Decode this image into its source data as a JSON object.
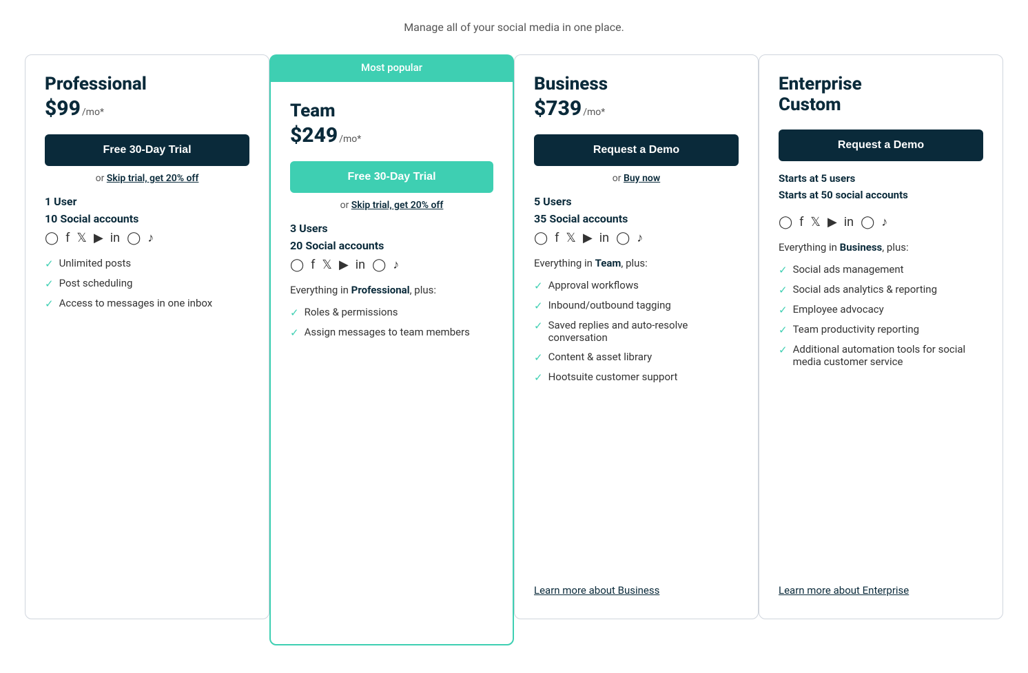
{
  "subtitle": "Manage all of your social media in one place.",
  "plans": [
    {
      "id": "professional",
      "name": "Professional",
      "price": "$99",
      "period": "/mo*",
      "badge": null,
      "primary_button": "Free 30-Day Trial",
      "primary_button_style": "dark",
      "secondary_link": "or",
      "secondary_link_text": "Skip trial, get 20% off",
      "users": "1 User",
      "social_accounts": "10 Social accounts",
      "social_icons": [
        "ⓘ",
        "f",
        "𝕏",
        "▶",
        "in",
        "ⓟ",
        "♪"
      ],
      "everything_in": null,
      "features": [
        "Unlimited posts",
        "Post scheduling",
        "Access to messages in one inbox"
      ],
      "learn_more": null,
      "starts_at": null,
      "starts_at2": null
    },
    {
      "id": "team",
      "name": "Team",
      "price": "$249",
      "period": "/mo*",
      "badge": "Most popular",
      "primary_button": "Free 30-Day Trial",
      "primary_button_style": "green",
      "secondary_link": "or",
      "secondary_link_text": "Skip trial, get 20% off",
      "users": "3 Users",
      "social_accounts": "20 Social accounts",
      "social_icons": [
        "ⓘ",
        "f",
        "𝕏",
        "▶",
        "in",
        "ⓟ",
        "♪"
      ],
      "everything_in": "Professional",
      "features": [
        "Roles & permissions",
        "Assign messages to team members"
      ],
      "learn_more": null,
      "starts_at": null,
      "starts_at2": null
    },
    {
      "id": "business",
      "name": "Business",
      "price": "$739",
      "period": "/mo*",
      "badge": null,
      "primary_button": "Request a Demo",
      "primary_button_style": "dark",
      "secondary_link": "or",
      "secondary_link_text": "Buy now",
      "users": "5 Users",
      "social_accounts": "35 Social accounts",
      "social_icons": [
        "ⓘ",
        "f",
        "𝕏",
        "▶",
        "in",
        "ⓟ",
        "♪"
      ],
      "everything_in": "Team",
      "features": [
        "Approval workflows",
        "Inbound/outbound tagging",
        "Saved replies and auto-resolve conversation",
        "Content & asset library",
        "Hootsuite customer support"
      ],
      "learn_more": "Learn more about Business",
      "starts_at": null,
      "starts_at2": null
    },
    {
      "id": "enterprise",
      "name": "Enterprise",
      "name2": "Custom",
      "price": null,
      "period": null,
      "badge": null,
      "primary_button": "Request a Demo",
      "primary_button_style": "dark",
      "secondary_link": null,
      "secondary_link_text": null,
      "users": null,
      "social_accounts": null,
      "social_icons": [
        "ⓘ",
        "f",
        "𝕏",
        "▶",
        "in",
        "ⓟ",
        "♪"
      ],
      "everything_in": "Business",
      "features": [
        "Social ads management",
        "Social ads analytics & reporting",
        "Employee advocacy",
        "Team productivity reporting",
        "Additional automation tools for social media customer service"
      ],
      "learn_more": "Learn more about Enterprise",
      "starts_at": "Starts at 5 users",
      "starts_at2": "Starts at 50 social accounts"
    }
  ]
}
